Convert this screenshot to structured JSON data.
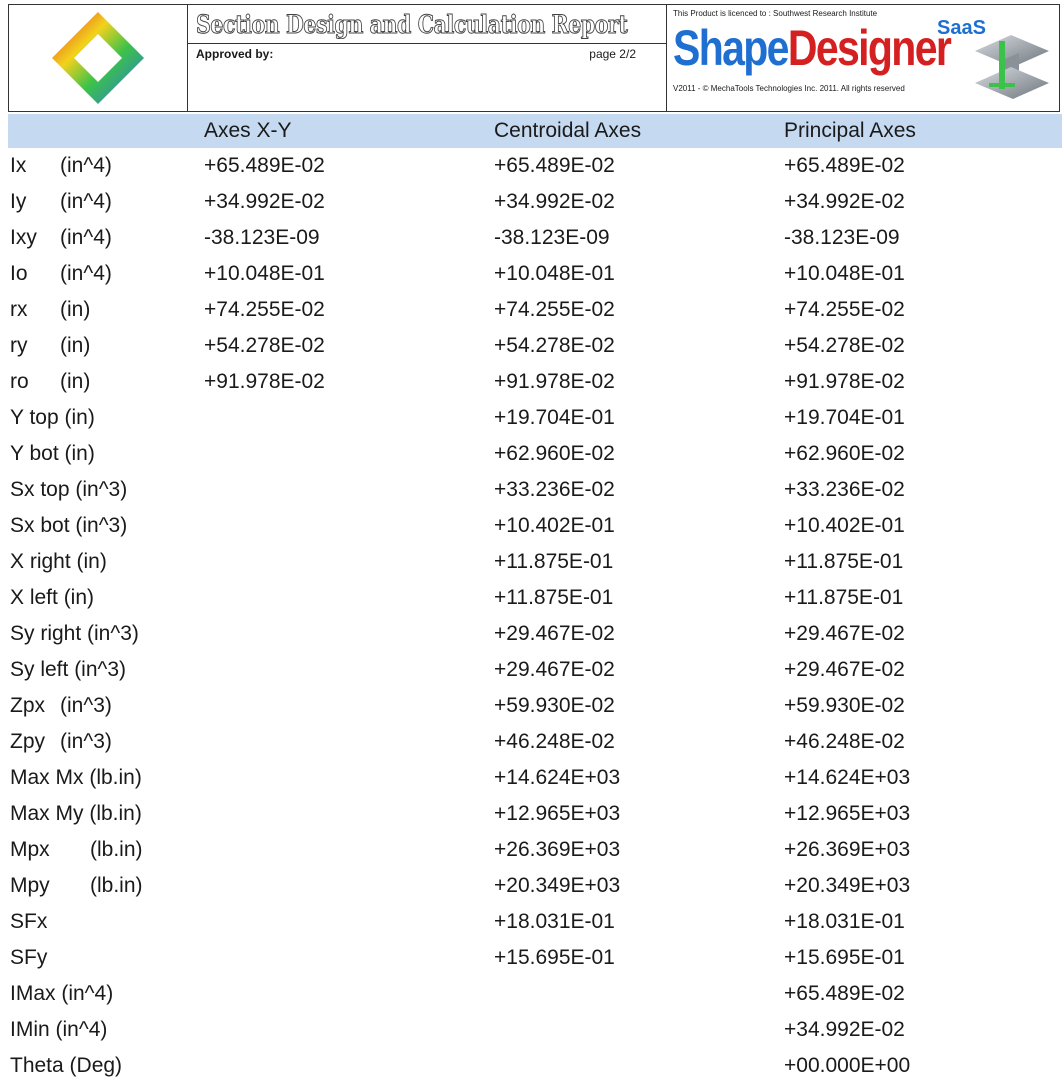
{
  "header": {
    "title": "Section Design and Calculation Report",
    "approved_label": "Approved by:",
    "page": "page 2/2",
    "licence_text": "This Product is licenced to : Southwest Research Institute",
    "brand_part1": "Shape",
    "brand_part2": "Designer",
    "brand_tag": "SaaS",
    "copyright": "V2011 - © MechaTools Technologies Inc. 2011. All rights reserved"
  },
  "table": {
    "columns": [
      "",
      "Axes X-Y",
      "Centroidal Axes",
      "Principal Axes"
    ],
    "rows": [
      {
        "label": "Ix",
        "unit": "(in^4)",
        "xy": "+65.489E-02",
        "centroidal": "+65.489E-02",
        "principal": "+65.489E-02"
      },
      {
        "label": "Iy",
        "unit": "(in^4)",
        "xy": "+34.992E-02",
        "centroidal": "+34.992E-02",
        "principal": "+34.992E-02"
      },
      {
        "label": "Ixy",
        "unit": "(in^4)",
        "xy": "-38.123E-09",
        "centroidal": "-38.123E-09",
        "principal": "-38.123E-09"
      },
      {
        "label": "Io",
        "unit": "(in^4)",
        "xy": "+10.048E-01",
        "centroidal": "+10.048E-01",
        "principal": "+10.048E-01"
      },
      {
        "label": "rx",
        "unit": "(in)",
        "xy": "+74.255E-02",
        "centroidal": "+74.255E-02",
        "principal": "+74.255E-02"
      },
      {
        "label": "ry",
        "unit": "(in)",
        "xy": "+54.278E-02",
        "centroidal": "+54.278E-02",
        "principal": "+54.278E-02"
      },
      {
        "label": "ro",
        "unit": "(in)",
        "xy": "+91.978E-02",
        "centroidal": "+91.978E-02",
        "principal": "+91.978E-02"
      },
      {
        "label": "Y top (in)",
        "unit": "",
        "xy": "",
        "centroidal": "+19.704E-01",
        "principal": "+19.704E-01"
      },
      {
        "label": "Y bot (in)",
        "unit": "",
        "xy": "",
        "centroidal": "+62.960E-02",
        "principal": "+62.960E-02"
      },
      {
        "label": "Sx top (in^3)",
        "unit": "",
        "xy": "",
        "centroidal": "+33.236E-02",
        "principal": "+33.236E-02"
      },
      {
        "label": "Sx bot (in^3)",
        "unit": "",
        "xy": "",
        "centroidal": "+10.402E-01",
        "principal": "+10.402E-01"
      },
      {
        "label": "X right (in)",
        "unit": "",
        "xy": "",
        "centroidal": "+11.875E-01",
        "principal": "+11.875E-01"
      },
      {
        "label": "X left (in)",
        "unit": "",
        "xy": "",
        "centroidal": "+11.875E-01",
        "principal": "+11.875E-01"
      },
      {
        "label": "Sy right (in^3)",
        "unit": "",
        "xy": "",
        "centroidal": "+29.467E-02",
        "principal": "+29.467E-02"
      },
      {
        "label": "Sy left (in^3)",
        "unit": "",
        "xy": "",
        "centroidal": "+29.467E-02",
        "principal": "+29.467E-02"
      },
      {
        "label": "Zpx",
        "unit": "(in^3)",
        "xy": "",
        "centroidal": "+59.930E-02",
        "principal": "+59.930E-02"
      },
      {
        "label": "Zpy",
        "unit": "(in^3)",
        "xy": "",
        "centroidal": "+46.248E-02",
        "principal": "+46.248E-02"
      },
      {
        "label": "Max Mx (lb.in)",
        "unit": "",
        "xy": "",
        "centroidal": "+14.624E+03",
        "principal": "+14.624E+03"
      },
      {
        "label": "Max My (lb.in)",
        "unit": "",
        "xy": "",
        "centroidal": "+12.965E+03",
        "principal": "+12.965E+03"
      },
      {
        "label": "Mpx",
        "unit": "(lb.in)",
        "xy": "",
        "centroidal": "+26.369E+03",
        "principal": "+26.369E+03"
      },
      {
        "label": "Mpy",
        "unit": "(lb.in)",
        "xy": "",
        "centroidal": "+20.349E+03",
        "principal": "+20.349E+03"
      },
      {
        "label": "SFx",
        "unit": "",
        "xy": "",
        "centroidal": "+18.031E-01",
        "principal": "+18.031E-01"
      },
      {
        "label": "SFy",
        "unit": "",
        "xy": "",
        "centroidal": "+15.695E-01",
        "principal": "+15.695E-01"
      },
      {
        "label": "IMax (in^4)",
        "unit": "",
        "xy": "",
        "centroidal": "",
        "principal": "+65.489E-02"
      },
      {
        "label": "IMin  (in^4)",
        "unit": "",
        "xy": "",
        "centroidal": "",
        "principal": "+34.992E-02"
      },
      {
        "label": "Theta (Deg)",
        "unit": "",
        "xy": "",
        "centroidal": "",
        "principal": "+00.000E+00"
      }
    ]
  }
}
